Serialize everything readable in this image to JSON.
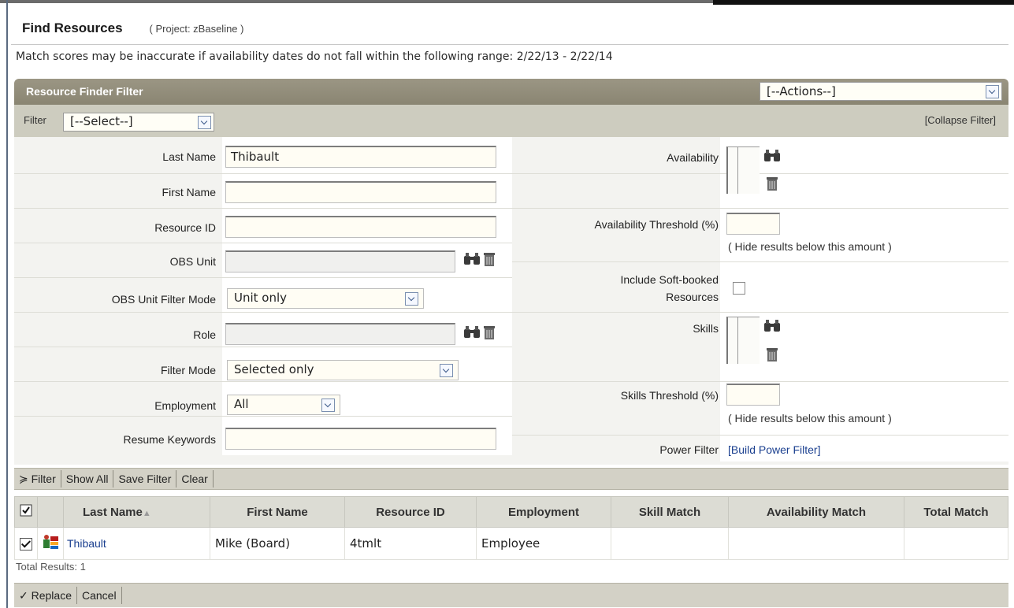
{
  "page": {
    "title": "Find Resources",
    "project": "( Project: zBaseline )",
    "note": "Match scores may be inaccurate if availability dates do not fall within the following range: 2/22/13 - 2/22/14"
  },
  "filter_panel": {
    "header": "Resource Finder Filter",
    "actions_value": "[--Actions--]",
    "filter_label": "Filter",
    "filter_select_value": "[--Select--]",
    "collapse_link": "[Collapse Filter]"
  },
  "left_fields": {
    "last_name": {
      "label": "Last Name",
      "value": "Thibault"
    },
    "first_name": {
      "label": "First Name",
      "value": ""
    },
    "resource_id": {
      "label": "Resource ID",
      "value": ""
    },
    "obs_unit": {
      "label": "OBS Unit",
      "value": ""
    },
    "obs_unit_filter_mode": {
      "label": "OBS Unit Filter Mode",
      "value": "Unit only"
    },
    "role": {
      "label": "Role",
      "value": ""
    },
    "filter_mode": {
      "label": "Filter Mode",
      "value": "Selected only"
    },
    "employment": {
      "label": "Employment",
      "value": "All"
    },
    "resume_keywords": {
      "label": "Resume Keywords",
      "value": ""
    }
  },
  "right_fields": {
    "availability": {
      "label": "Availability"
    },
    "availability_threshold": {
      "label": "Availability Threshold (%)",
      "hint": "( Hide results below this amount )"
    },
    "soft_booked": {
      "label_line1": "Include Soft-booked",
      "label_line2": "Resources",
      "checked": false
    },
    "skills": {
      "label": "Skills"
    },
    "skills_threshold": {
      "label": "Skills Threshold (%)",
      "hint": "( Hide results below this amount )"
    },
    "power_filter": {
      "label": "Power Filter",
      "link": "[Build Power Filter]"
    }
  },
  "filter_buttons": [
    "Filter",
    "Show All",
    "Save Filter",
    "Clear"
  ],
  "results": {
    "columns": [
      "Last Name",
      "First Name",
      "Resource ID",
      "Employment",
      "Skill Match",
      "Availability Match",
      "Total Match"
    ],
    "rows": [
      {
        "last_name": "Thibault",
        "first_name": "Mike (Board)",
        "resource_id": "4tmlt",
        "employment": "Employee",
        "skill_match": "",
        "availability_match": "",
        "total_match": ""
      }
    ],
    "total": "Total Results: 1"
  },
  "bottom_buttons": {
    "replace": "Replace",
    "cancel": "Cancel"
  },
  "icons": [
    "binoculars-icon",
    "trash-icon",
    "resource-icon",
    "sort-asc-icon",
    "select-all-icon"
  ],
  "colors": {
    "header_bg": "#8f8a77",
    "bar_bg": "#cdccbf",
    "link": "#1a3f8f",
    "input_bg": "#fffdf4"
  }
}
